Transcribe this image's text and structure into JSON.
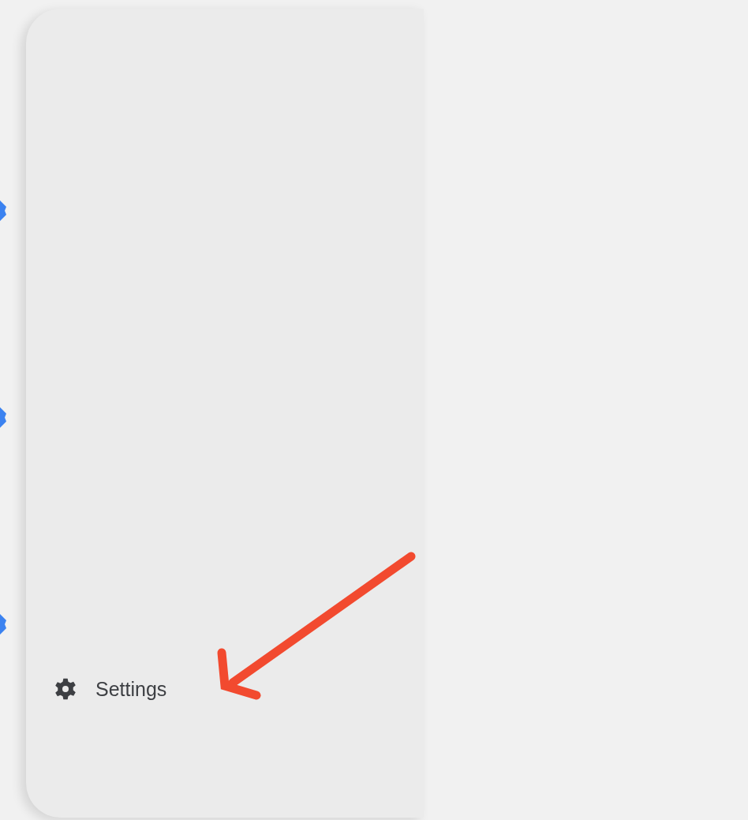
{
  "sidebar": {
    "items": [
      {
        "label": "Settings"
      }
    ]
  }
}
